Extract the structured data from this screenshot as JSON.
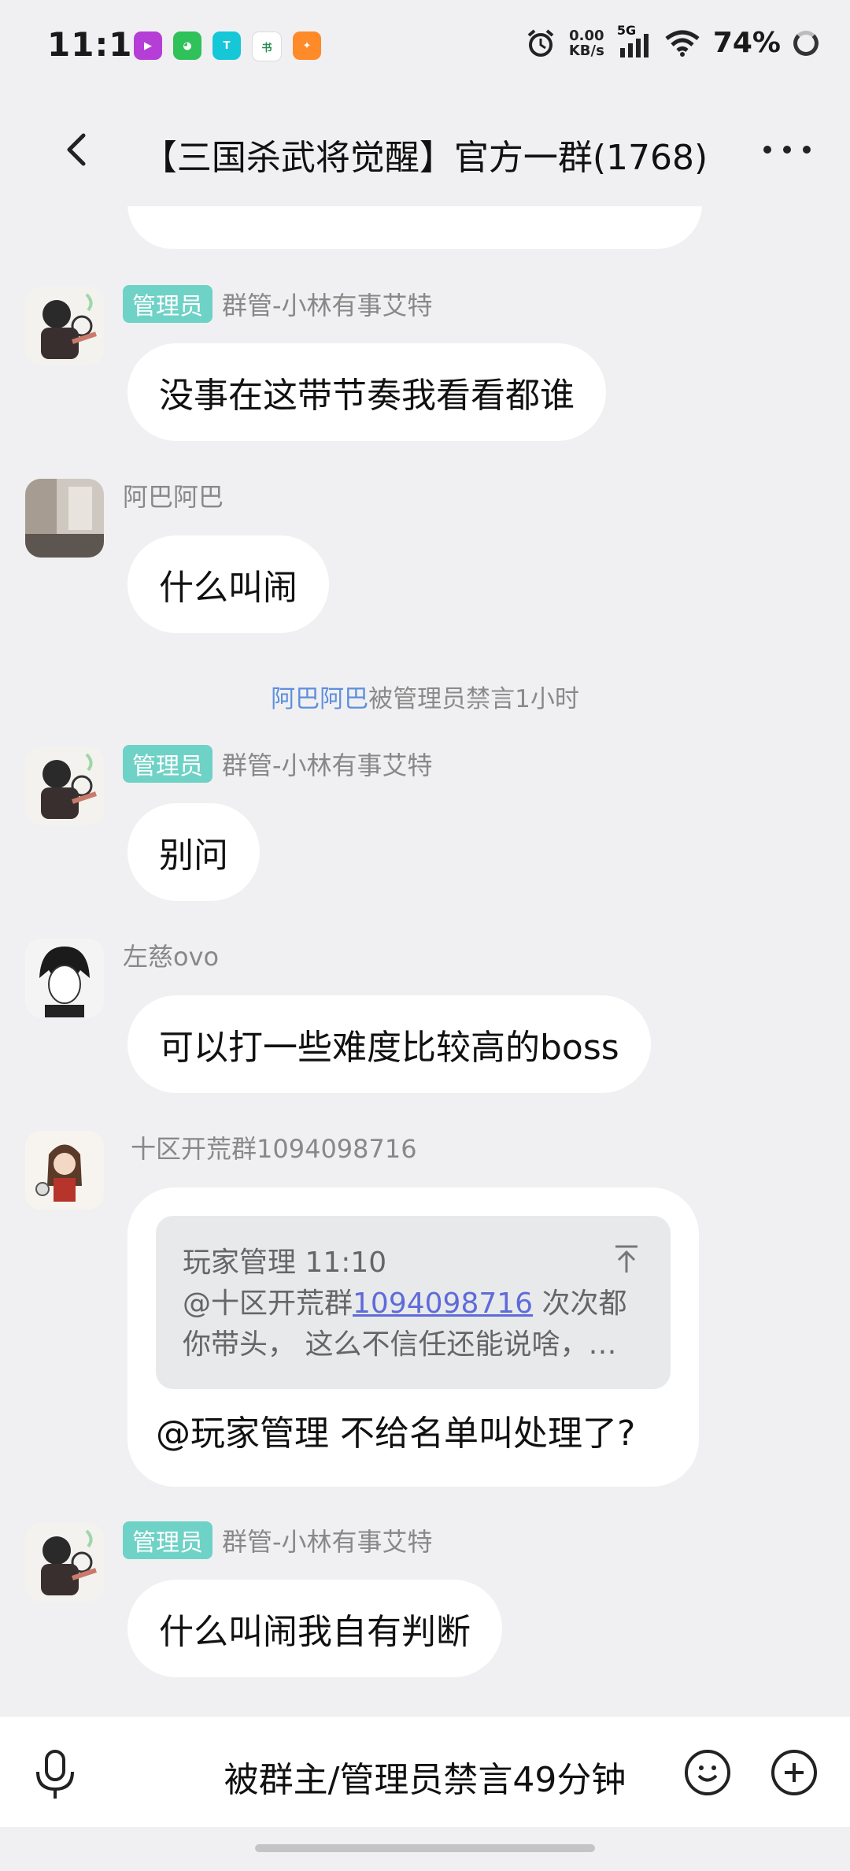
{
  "status_bar": {
    "time": "11:14",
    "net_speed_value": "0.00",
    "net_speed_unit": "KB/s",
    "signal": "5G",
    "battery": "74%",
    "app_icons": [
      "video-app-icon",
      "wechat-icon",
      "taptap-icon",
      "book-app-icon",
      "game-app-icon"
    ]
  },
  "header": {
    "title": "【三国杀武将觉醒】官方一群(1768)"
  },
  "colors": {
    "admin_badge": "#6fd2c6",
    "link": "#5e8fdc",
    "background": "#f0f0f2"
  },
  "messages": [
    {
      "sender": "群管-小林有事艾特",
      "badge": "管理员",
      "text": "没事在这带节奏我看看都谁"
    },
    {
      "sender": "阿巴阿巴",
      "text": "什么叫闹"
    },
    {
      "sender": "群管-小林有事艾特",
      "badge": "管理员",
      "text": "别问"
    },
    {
      "sender": "左慈ovo",
      "text": "可以打一些难度比较高的boss"
    },
    {
      "sender": "十区开荒群1094098716",
      "text": "@玩家管理 不给名单叫处理了?"
    },
    {
      "sender": "群管-小林有事艾特",
      "badge": "管理员",
      "text": "什么叫闹我自有判断"
    }
  ],
  "system_notice": {
    "name": "阿巴阿巴",
    "rest": "被管理员禁言1小时"
  },
  "reply": {
    "author_time": "玩家管理 11:10",
    "prefix": "@十区开荒群",
    "number": "1094098716",
    "suffix": " 次次都",
    "line2": "你带头， 这么不信任还能说啥，…"
  },
  "input_bar": {
    "mute_text": "被群主/管理员禁言49分钟"
  }
}
